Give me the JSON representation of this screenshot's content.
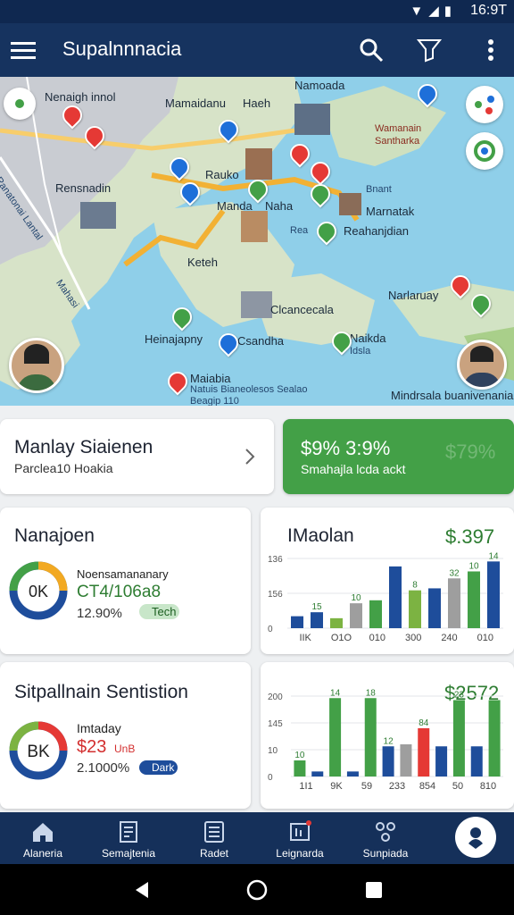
{
  "status_bar": {
    "time": "16:9T"
  },
  "app_bar": {
    "title": "Supalnnnacia"
  },
  "map": {
    "labels": {
      "l1": "Nenaigh innol",
      "l2": "Mamaidanu",
      "l3": "Haeh",
      "l4": "Namoada",
      "l5": "Wamanain",
      "l6": "Santharka",
      "l7": "Rauko",
      "l8": "Rensnadin",
      "l9": "Manda",
      "l10": "Naha",
      "l11": "Bnant",
      "l12": "Marnatak",
      "l13": "Rea",
      "l14": "Reahanjdian",
      "l15": "Keteh",
      "l16": "Narlaruay",
      "l17": "Clcancecala",
      "l18": "Heinajapny",
      "l19": "Csandha",
      "l20": "Naikda",
      "l21": "Idsla",
      "l22": "Maiabia",
      "l23": "Natuis Bianeolesos Sealao",
      "l24": "Beagip 110",
      "l25": "Mindrsala",
      "l26": "buanivenania",
      "road1": "Ranatonai Lantal",
      "road2": "Mahasi"
    }
  },
  "cards": {
    "row1_left": {
      "title": "Manlay Siaienen",
      "subtitle": "Parclea10 Hoakia"
    },
    "row1_right": {
      "title": "$9% 3:9%",
      "subtitle": "Smahajla lcda ackt",
      "ghost": "$79%"
    },
    "row2_left": {
      "title": "Nanajoen",
      "donut_label": "0K",
      "line1": "Noensamananary",
      "line2": "CT4/106a8",
      "line3": "12.90%",
      "tag": "Tech"
    },
    "row2_right": {
      "title": "IMaolan",
      "value": "$.397"
    },
    "row3_left": {
      "title": "Sitpallnain Sentistion",
      "donut_label": "BK",
      "line1": "Imtaday",
      "line2": "$23",
      "line2b": "UnB",
      "line3": "2.1000%",
      "tag": "Dark"
    },
    "row3_right": {
      "value": "$2572"
    }
  },
  "chart_data": [
    {
      "type": "bar",
      "title": "IMaolan",
      "y_ticks": [
        "136",
        "156",
        "0"
      ],
      "x_ticks": [
        "IIK",
        "O1O",
        "010",
        "300",
        "240",
        "010"
      ],
      "bar_values": [
        12,
        16,
        10,
        25,
        28,
        62,
        38,
        40,
        50,
        57,
        67
      ],
      "bar_colors": [
        "#1e4d9b",
        "#1e4d9b",
        "#7cb342",
        "#9e9e9e",
        "#43a047",
        "#1e4d9b",
        "#7cb342",
        "#1e4d9b",
        "#9e9e9e",
        "#43a047",
        "#1e4d9b"
      ],
      "data_labels": [
        {
          "bar": 1,
          "text": "15"
        },
        {
          "bar": 3,
          "text": "10"
        },
        {
          "bar": 6,
          "text": "8"
        },
        {
          "bar": 8,
          "text": "32"
        },
        {
          "bar": 9,
          "text": "10"
        },
        {
          "bar": 10,
          "text": "14"
        }
      ]
    },
    {
      "type": "bar",
      "title": "",
      "y_ticks": [
        "200",
        "145",
        "10",
        "0"
      ],
      "x_ticks": [
        "1I1",
        "9K",
        "59",
        "233",
        "854",
        "50",
        "810"
      ],
      "bar_values": [
        16,
        5,
        78,
        5,
        78,
        30,
        32,
        48,
        30,
        76,
        30,
        76
      ],
      "bar_colors": [
        "#43a047",
        "#1e4d9b",
        "#43a047",
        "#1e4d9b",
        "#43a047",
        "#1e4d9b",
        "#9e9e9e",
        "#e53935",
        "#1e4d9b",
        "#43a047",
        "#1e4d9b",
        "#43a047"
      ],
      "data_labels": [
        {
          "bar": 0,
          "text": "10"
        },
        {
          "bar": 2,
          "text": "14"
        },
        {
          "bar": 4,
          "text": "18"
        },
        {
          "bar": 5,
          "text": "12"
        },
        {
          "bar": 7,
          "text": "84"
        },
        {
          "bar": 9,
          "text": "23"
        }
      ]
    }
  ],
  "bottom_nav": [
    {
      "label": "Alaneria"
    },
    {
      "label": "Semajtenia"
    },
    {
      "label": "Radet"
    },
    {
      "label": "Leignarda"
    },
    {
      "label": "Sunpiada"
    }
  ],
  "colors": {
    "accent": "#16335f",
    "success": "#43a047",
    "danger": "#e53935"
  }
}
